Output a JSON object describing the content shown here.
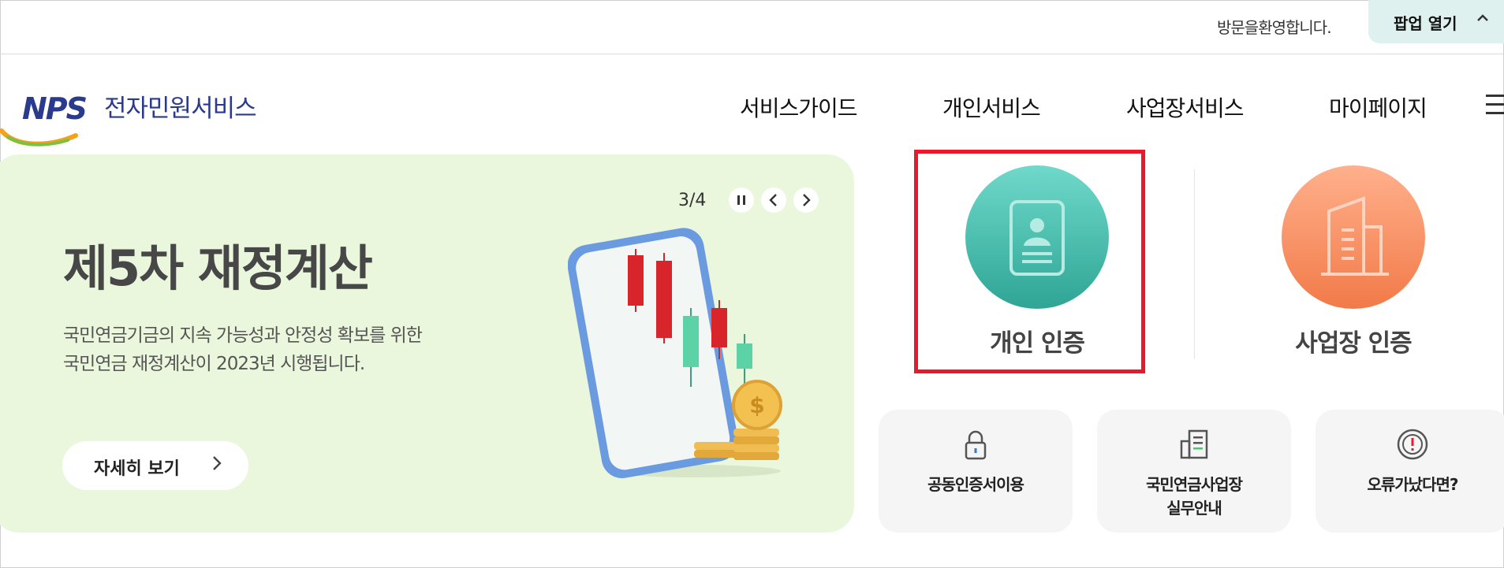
{
  "topbar": {
    "welcome": "방문을환영합니다.",
    "popup_label": "팝업 열기",
    "popup_chevron": "^"
  },
  "header": {
    "logo_mark": "NPS",
    "logo_text": "전자민원서비스",
    "nav": [
      "서비스가이드",
      "개인서비스",
      "사업장서비스",
      "마이페이지"
    ],
    "menu_icon": "hamburger-icon"
  },
  "banner": {
    "title": "제5차 재정계산",
    "description": [
      "국민연금기금의 지속 가능성과 안정성 확보를 위한",
      "국민연금 재정계산이 2023년 시행됩니다."
    ],
    "detail_label": "자세히 보기",
    "counter": "3/4",
    "background": "#ebf7dc"
  },
  "auth": {
    "personal_label": "개인 인증",
    "personal_color": "#3bb4a4",
    "business_label": "사업장 인증",
    "business_color": "#f58a5c",
    "highlight_color": "#e8192c"
  },
  "tiles": [
    {
      "label": "공동인증서이용",
      "icon": "lock-icon"
    },
    {
      "label": "국민연금사업장\n실무안내",
      "icon": "document-icon"
    },
    {
      "label": "오류가났다면?",
      "icon": "exclamation-circle-icon"
    }
  ]
}
